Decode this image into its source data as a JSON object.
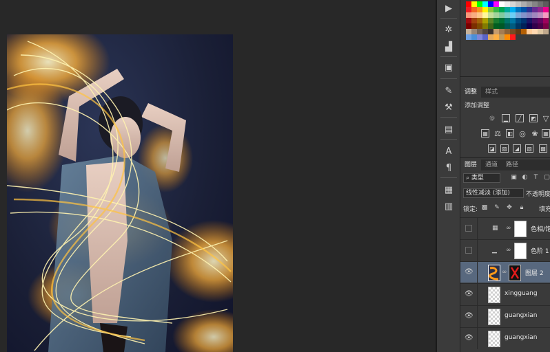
{
  "swatch_colors": [
    [
      "#ff0000",
      "#ffff00",
      "#00ff00",
      "#00ffff",
      "#0000ff",
      "#ff00ff",
      "#ffffff",
      "#ebebeb",
      "#d6d6d6",
      "#c2c2c2",
      "#adadad",
      "#999999",
      "#858585",
      "#707070",
      "#5c5c5c"
    ],
    [
      "#ed1c24",
      "#f26522",
      "#f7941d",
      "#fff200",
      "#8dc63f",
      "#39b54a",
      "#00a651",
      "#00a99d",
      "#00aeef",
      "#0072bc",
      "#0054a6",
      "#2e3192",
      "#662d91",
      "#92278f",
      "#ec008c"
    ],
    [
      "#f7977a",
      "#f9ad81",
      "#fdc689",
      "#fff799",
      "#c4df9b",
      "#a3d39c",
      "#82ca9d",
      "#7bcdc8",
      "#6ecff6",
      "#7ea7d8",
      "#8393ca",
      "#8781bd",
      "#a187be",
      "#bd8cbf",
      "#f49ac1"
    ],
    [
      "#9e0b0f",
      "#a0410d",
      "#a36209",
      "#aba000",
      "#598527",
      "#197b30",
      "#007236",
      "#00746b",
      "#0076a3",
      "#004a80",
      "#003471",
      "#1b1464",
      "#440e62",
      "#630460",
      "#9e005d"
    ],
    [
      "#790000",
      "#7b2e00",
      "#7d4900",
      "#827b00",
      "#406618",
      "#005e20",
      "#005826",
      "#005952",
      "#005b7f",
      "#003663",
      "#002157",
      "#0d004c",
      "#32004b",
      "#4b0049",
      "#7b0046"
    ],
    [
      "#c7b299",
      "#998675",
      "#736357",
      "#534741",
      "#37302d",
      "#c69c6d",
      "#a67c52",
      "#8c6239",
      "#754c24",
      "#603913",
      "#b45f04",
      "#ffcc99",
      "#ffd8b1",
      "#dfc7a2",
      "#bfa88c"
    ],
    [
      "#6ea1e4",
      "#4b8fd9",
      "#7f86d9",
      "#5b64c7",
      "#e0a960",
      "#ffb043",
      "#c19a5b",
      "#ff8a00",
      "#ff1b1b"
    ]
  ],
  "adjustments": {
    "tabs": [
      "调整",
      "样式"
    ],
    "title": "添加调整"
  },
  "layers": {
    "tabs": [
      "图层",
      "通道",
      "路径"
    ],
    "filter_label": "⌕ 类型",
    "blend_mode": "线性减淡 (添加)",
    "opacity_label": "不透明度",
    "lock_label": "锁定:",
    "fill_label": "填充",
    "rows": [
      {
        "name": "色相/饱"
      },
      {
        "name": "色阶 1"
      },
      {
        "name": "图层 2"
      },
      {
        "name": "xingguang"
      },
      {
        "name": "guangxian"
      },
      {
        "name": "guangxian"
      }
    ]
  }
}
